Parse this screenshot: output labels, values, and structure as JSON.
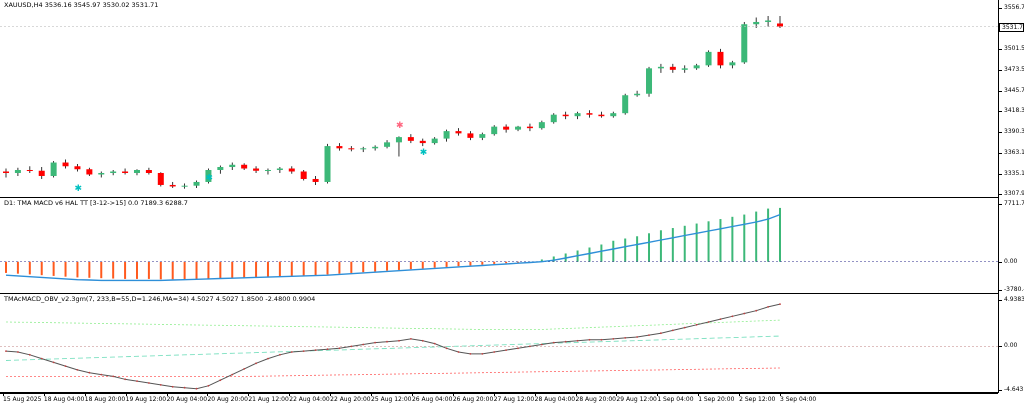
{
  "symbol_header": "XAUUSD,H4  3536.16 3545.97 3530.02 3531.71",
  "macd_header": "D1: TMA MACD v6 HAL TT [3-12->15] 0.0 7189.3 6288.7",
  "obv_header": "TMAcMACD_OBV_v2.3gm(7, 233,B=55,D=1.246,MA=34) 4.5027 4.5027 1.8500 -2.4800 0.9904",
  "price_axis": [
    "3556.70",
    "3531.71",
    "3501.50",
    "3473.50",
    "3445.70",
    "3418.30",
    "3390.30",
    "3363.10",
    "3335.10",
    "3307.90"
  ],
  "current_price": "3531.71",
  "macd_axis": [
    "7711.7",
    "0.00",
    "-3780.4"
  ],
  "obv_axis": [
    "4.9383",
    "0.00",
    "-4.643"
  ],
  "time_axis": [
    "15 Aug 2025",
    "18 Aug 04:00",
    "18 Aug 20:00",
    "19 Aug 12:00",
    "20 Aug 04:00",
    "20 Aug 20:00",
    "21 Aug 12:00",
    "22 Aug 04:00",
    "22 Aug 20:00",
    "25 Aug 12:00",
    "26 Aug 04:00",
    "26 Aug 20:00",
    "27 Aug 12:00",
    "28 Aug 04:00",
    "28 Aug 20:00",
    "29 Aug 12:00",
    "1 Sep 04:00",
    "1 Sep 20:00",
    "2 Sep 12:00",
    "3 Sep 04:00"
  ],
  "colors": {
    "bull": "#3cb878",
    "bear": "#ff0000",
    "hist_pos": "#3cb878",
    "hist_neg": "#ff5a1e",
    "macd_line": "#2e8fd8",
    "obv_line": "#555555",
    "signal_line": "#7be0c0",
    "upper_band": "#90ee90",
    "lower_band": "#ff6060",
    "arrow_up": "#00c0c0",
    "arrow_down": "#ff6680"
  },
  "chart_data": {
    "type": "candlestick",
    "series": [
      {
        "name": "XAUUSD,H4",
        "values": [
          [
            3338,
            3342,
            3330,
            3336
          ],
          [
            3336,
            3343,
            3332,
            3340
          ],
          [
            3340,
            3345,
            3336,
            3339
          ],
          [
            3339,
            3344,
            3328,
            3332
          ],
          [
            3332,
            3352,
            3330,
            3350
          ],
          [
            3350,
            3354,
            3342,
            3345
          ],
          [
            3345,
            3348,
            3338,
            3341
          ],
          [
            3341,
            3343,
            3332,
            3334
          ],
          [
            3334,
            3338,
            3330,
            3336
          ],
          [
            3336,
            3340,
            3333,
            3338
          ],
          [
            3338,
            3342,
            3334,
            3336
          ],
          [
            3336,
            3341,
            3333,
            3340
          ],
          [
            3340,
            3343,
            3334,
            3336
          ],
          [
            3336,
            3337,
            3318,
            3320
          ],
          [
            3320,
            3324,
            3316,
            3318
          ],
          [
            3318,
            3322,
            3315,
            3319
          ],
          [
            3319,
            3326,
            3316,
            3324
          ],
          [
            3324,
            3342,
            3322,
            3340
          ],
          [
            3340,
            3346,
            3335,
            3344
          ],
          [
            3344,
            3350,
            3340,
            3347
          ],
          [
            3347,
            3349,
            3340,
            3342
          ],
          [
            3342,
            3345,
            3336,
            3339
          ],
          [
            3339,
            3342,
            3334,
            3340
          ],
          [
            3340,
            3344,
            3336,
            3342
          ],
          [
            3342,
            3345,
            3335,
            3338
          ],
          [
            3338,
            3340,
            3326,
            3328
          ],
          [
            3328,
            3332,
            3320,
            3324
          ],
          [
            3324,
            3375,
            3322,
            3372
          ],
          [
            3372,
            3376,
            3366,
            3369
          ],
          [
            3369,
            3372,
            3365,
            3368
          ],
          [
            3368,
            3371,
            3364,
            3369
          ],
          [
            3369,
            3373,
            3366,
            3371
          ],
          [
            3371,
            3380,
            3369,
            3377
          ],
          [
            3377,
            3385,
            3358,
            3384
          ],
          [
            3384,
            3388,
            3376,
            3379
          ],
          [
            3379,
            3382,
            3372,
            3376
          ],
          [
            3376,
            3384,
            3374,
            3382
          ],
          [
            3382,
            3394,
            3378,
            3392
          ],
          [
            3392,
            3396,
            3386,
            3389
          ],
          [
            3389,
            3392,
            3380,
            3383
          ],
          [
            3383,
            3390,
            3380,
            3388
          ],
          [
            3388,
            3400,
            3386,
            3398
          ],
          [
            3398,
            3401,
            3390,
            3394
          ],
          [
            3394,
            3399,
            3392,
            3398
          ],
          [
            3398,
            3402,
            3392,
            3396
          ],
          [
            3396,
            3406,
            3394,
            3404
          ],
          [
            3404,
            3416,
            3402,
            3414
          ],
          [
            3414,
            3418,
            3408,
            3412
          ],
          [
            3412,
            3418,
            3408,
            3416
          ],
          [
            3416,
            3420,
            3410,
            3414
          ],
          [
            3414,
            3418,
            3410,
            3412
          ],
          [
            3412,
            3418,
            3410,
            3416
          ],
          [
            3416,
            3442,
            3414,
            3440
          ],
          [
            3440,
            3446,
            3438,
            3442
          ],
          [
            3442,
            3478,
            3438,
            3476
          ],
          [
            3476,
            3482,
            3470,
            3478
          ],
          [
            3478,
            3482,
            3470,
            3474
          ],
          [
            3474,
            3480,
            3470,
            3476
          ],
          [
            3476,
            3482,
            3474,
            3480
          ],
          [
            3480,
            3500,
            3478,
            3498
          ],
          [
            3498,
            3502,
            3476,
            3480
          ],
          [
            3480,
            3486,
            3476,
            3484
          ],
          [
            3484,
            3538,
            3482,
            3535
          ],
          [
            3535,
            3544,
            3530,
            3538
          ],
          [
            3538,
            3546,
            3532,
            3540
          ],
          [
            3536,
            3546,
            3530,
            3532
          ]
        ]
      }
    ],
    "macd_histogram": [
      -1500,
      -1600,
      -1700,
      -1800,
      -1900,
      -2000,
      -2100,
      -2150,
      -2200,
      -2250,
      -2300,
      -2300,
      -2300,
      -2350,
      -2350,
      -2350,
      -2300,
      -2250,
      -2200,
      -2150,
      -2100,
      -2050,
      -2000,
      -1950,
      -1900,
      -1850,
      -1800,
      -1700,
      -1600,
      -1500,
      -1400,
      -1300,
      -1200,
      -1100,
      -1000,
      -900,
      -800,
      -700,
      -600,
      -500,
      -400,
      -300,
      -200,
      -100,
      0,
      300,
      700,
      1100,
      1500,
      1900,
      2300,
      2800,
      3100,
      3400,
      3800,
      4200,
      4500,
      4800,
      5100,
      5400,
      5700,
      6000,
      6300,
      6700,
      7100,
      7189.3
    ],
    "macd_line": [
      -1800,
      -1900,
      -2000,
      -2100,
      -2200,
      -2300,
      -2400,
      -2450,
      -2500,
      -2500,
      -2500,
      -2500,
      -2500,
      -2500,
      -2450,
      -2400,
      -2350,
      -2300,
      -2250,
      -2200,
      -2150,
      -2100,
      -2050,
      -2000,
      -1950,
      -1900,
      -1850,
      -1800,
      -1700,
      -1600,
      -1500,
      -1400,
      -1300,
      -1200,
      -1100,
      -1000,
      -900,
      -800,
      -700,
      -600,
      -500,
      -400,
      -300,
      -200,
      -100,
      0,
      200,
      500,
      800,
      1100,
      1400,
      1700,
      2000,
      2300,
      2600,
      2900,
      3200,
      3500,
      3800,
      4100,
      4400,
      4700,
      5000,
      5300,
      5700,
      6288.7
    ],
    "obv_line": [
      -0.5,
      -0.6,
      -0.9,
      -1.3,
      -1.7,
      -2.1,
      -2.5,
      -2.8,
      -3.0,
      -3.2,
      -3.5,
      -3.7,
      -3.9,
      -4.1,
      -4.3,
      -4.4,
      -4.5,
      -4.2,
      -3.6,
      -3.0,
      -2.4,
      -1.8,
      -1.3,
      -0.9,
      -0.6,
      -0.5,
      -0.4,
      -0.3,
      -0.2,
      0.0,
      0.2,
      0.4,
      0.5,
      0.6,
      0.8,
      0.6,
      0.3,
      -0.2,
      -0.6,
      -0.8,
      -0.8,
      -0.6,
      -0.4,
      -0.2,
      0.0,
      0.2,
      0.4,
      0.5,
      0.6,
      0.7,
      0.7,
      0.8,
      0.9,
      1.0,
      1.2,
      1.4,
      1.7,
      2.0,
      2.3,
      2.6,
      2.9,
      3.2,
      3.5,
      3.8,
      4.2,
      4.5027
    ],
    "obv_ylim": [
      -4.643,
      4.9383
    ],
    "macd_ylim": [
      -3780.4,
      7711.7
    ],
    "price_ylim": [
      3307.9,
      3556.7
    ]
  }
}
